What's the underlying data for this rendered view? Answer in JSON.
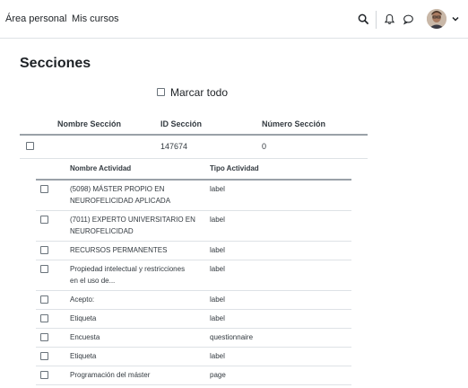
{
  "header": {
    "nav_links": [
      "Área personal",
      "Mis cursos"
    ],
    "icons": [
      "search-icon",
      "bell-icon",
      "chat-icon",
      "chevron-down-icon"
    ]
  },
  "page": {
    "title": "Secciones",
    "mark_all_label": "Marcar todo"
  },
  "sections_table": {
    "headers": [
      "Nombre Sección",
      "ID Sección",
      "Número Sección"
    ],
    "rows": [
      {
        "name": "",
        "id": "147674",
        "number": "0"
      }
    ]
  },
  "activities_table": {
    "headers": [
      "Nombre Actividad",
      "Tipo Actividad"
    ],
    "rows": [
      {
        "name_lines": [
          "(5098) MÁSTER PROPIO EN",
          "NEUROFELICIDAD APLICADA"
        ],
        "type": "label"
      },
      {
        "name_lines": [
          "(7011) EXPERTO UNIVERSITARIO EN",
          "NEUROFELICIDAD"
        ],
        "type": "label"
      },
      {
        "name_lines": [
          "RECURSOS PERMANENTES"
        ],
        "type": "label"
      },
      {
        "name_lines": [
          "Propiedad intelectual y restricciones",
          "en el uso de..."
        ],
        "type": "label"
      },
      {
        "name_lines": [
          "Acepto:"
        ],
        "type": "label"
      },
      {
        "name_lines": [
          "Etiqueta"
        ],
        "type": "label"
      },
      {
        "name_lines": [
          "Encuesta"
        ],
        "type": "questionnaire"
      },
      {
        "name_lines": [
          "Etiqueta"
        ],
        "type": "label"
      },
      {
        "name_lines": [
          "Programación del máster"
        ],
        "type": "page"
      }
    ]
  },
  "colors": {
    "text": "#1d2125",
    "border": "#dee2e6",
    "header_border": "#9aa1a8"
  }
}
